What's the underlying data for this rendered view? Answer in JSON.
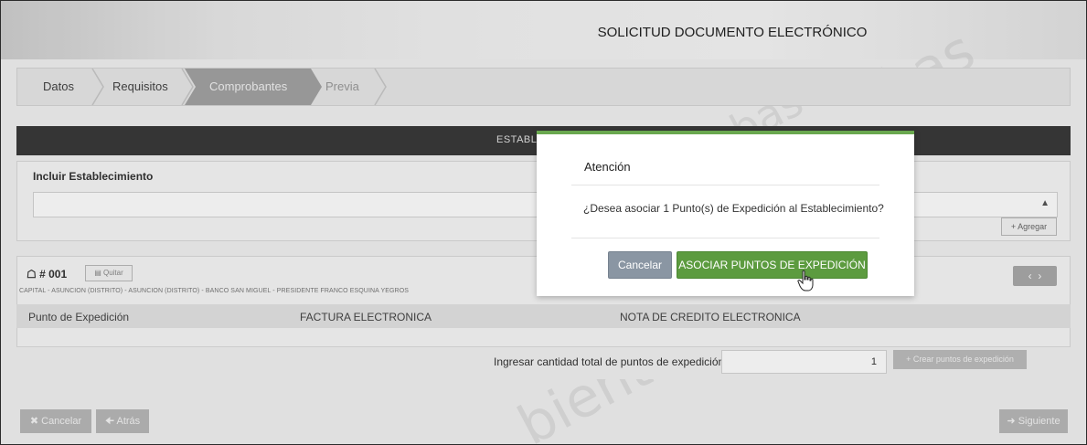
{
  "header": {
    "title": "SOLICITUD DOCUMENTO ELECTRÓNICO"
  },
  "steps": [
    {
      "label": "Datos",
      "state": "done"
    },
    {
      "label": "Requisitos",
      "state": "done"
    },
    {
      "label": "Comprobantes",
      "state": "active"
    },
    {
      "label": "Previa",
      "state": "pending"
    }
  ],
  "section": {
    "title": "ESTABL"
  },
  "include": {
    "title": "Incluir Establecimiento",
    "select_value": "",
    "add_label": "Agregar"
  },
  "establishment": {
    "id_label": "# 001",
    "remove_label": "Quitar",
    "address": "CAPITAL - ASUNCION (DISTRITO) - ASUNCION (DISTRITO) - BANCO SAN MIGUEL - PRESIDENTE FRANCO ESQUINA YEGROS",
    "columns": [
      "Punto de Expedición",
      "FACTURA ELECTRONICA",
      "NOTA DE CREDITO ELECTRONICA"
    ],
    "quantity_label": "Ingresar cantidad total de puntos de expedición",
    "quantity_value": "1",
    "create_label": "Crear puntos de expedición"
  },
  "footer": {
    "cancel_label": "Cancelar",
    "back_label": "Atrás",
    "next_label": "Siguiente"
  },
  "modal": {
    "title": "Atención",
    "message": "¿Desea asociar 1 Punto(s) de Expedición al Establecimiento?",
    "cancel_label": "Cancelar",
    "confirm_label": "ASOCIAR PUNTOS DE EXPEDICIÓN"
  },
  "colors": {
    "accent_green": "#5c9b3f",
    "modal_border": "#6aa84f",
    "cancel_gray": "#8a96a3"
  },
  "icons": [
    "home-icon",
    "trash-icon",
    "plus-icon",
    "times-icon",
    "arrow-left-icon",
    "arrow-right-icon",
    "chevron-left-icon",
    "chevron-right-icon",
    "hand-pointer-icon"
  ]
}
